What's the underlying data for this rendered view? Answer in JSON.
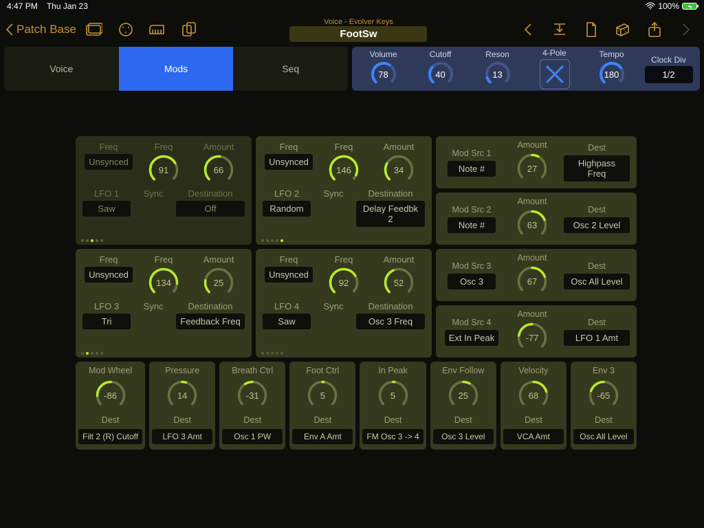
{
  "status": {
    "time": "4:47 PM",
    "date": "Thu Jan 23",
    "battery": "100%"
  },
  "nav": {
    "back": "Patch Base",
    "title_top": "Voice - Evolver Keys",
    "title_main": "FootSw"
  },
  "tabs": [
    "Voice",
    "Mods",
    "Seq"
  ],
  "active_tab": 1,
  "globals": {
    "volume": {
      "label": "Volume",
      "value": 78,
      "pct": 0.62
    },
    "cutoff": {
      "label": "Cutoff",
      "value": 40,
      "pct": 0.31
    },
    "reson": {
      "label": "Reson",
      "value": 13,
      "pct": 0.1
    },
    "pole": {
      "label": "4-Pole"
    },
    "tempo": {
      "label": "Tempo",
      "value": 180,
      "pct": 0.7
    },
    "clock": {
      "label": "Clock Div",
      "value": "1/2"
    }
  },
  "lfos": [
    {
      "name": "LFO 1",
      "dim": true,
      "freq_mode": "Unsynced",
      "freq": 91,
      "freq_pct": 0.72,
      "amount": 66,
      "amount_pct": 0.52,
      "sync": "Sync",
      "dest_lbl": "Destination",
      "wave": "Saw",
      "dest": "Off",
      "dots": [
        0,
        0,
        1,
        0,
        0
      ]
    },
    {
      "name": "LFO 2",
      "dim": false,
      "freq_mode": "Unsynced",
      "freq": 146,
      "freq_pct": 0.92,
      "amount": 34,
      "amount_pct": 0.27,
      "sync": "Sync",
      "dest_lbl": "Destination",
      "wave": "Random",
      "dest": "Delay Feedbk 2",
      "dots": [
        0,
        0,
        0,
        0,
        1
      ]
    },
    {
      "name": "LFO 3",
      "dim": false,
      "freq_mode": "Unsynced",
      "freq": 134,
      "freq_pct": 0.85,
      "amount": 25,
      "amount_pct": 0.2,
      "sync": "Sync",
      "dest_lbl": "Destination",
      "wave": "Tri",
      "dest": "Feedback Freq",
      "dots": [
        0,
        1,
        0,
        0,
        0
      ]
    },
    {
      "name": "LFO 4",
      "dim": false,
      "freq_mode": "Unsynced",
      "freq": 92,
      "freq_pct": 0.72,
      "amount": 52,
      "amount_pct": 0.41,
      "sync": "Sync",
      "dest_lbl": "Destination",
      "wave": "Saw",
      "dest": "Osc 3 Freq",
      "dots": [
        0,
        0,
        0,
        0,
        0
      ]
    }
  ],
  "mods": [
    {
      "label": "Mod Src 1",
      "src": "Note #",
      "amount": 27,
      "bipct": 0.6,
      "dest": "Highpass Freq"
    },
    {
      "label": "Mod Src 2",
      "src": "Note #",
      "amount": 63,
      "bipct": 0.75,
      "dest": "Osc 2 Level"
    },
    {
      "label": "Mod Src 3",
      "src": "Osc 3",
      "amount": 67,
      "bipct": 0.76,
      "dest": "Osc All Level"
    },
    {
      "label": "Mod Src 4",
      "src": "Ext In Peak",
      "amount": -77,
      "bipct": 0.2,
      "dest": "LFO 1 Amt"
    }
  ],
  "strip": [
    {
      "label": "Mod Wheel",
      "value": -86,
      "bipct": 0.16,
      "dest_lbl": "Dest",
      "dest": "Filt 2 (R) Cutoff"
    },
    {
      "label": "Pressure",
      "value": 14,
      "bipct": 0.56,
      "dest_lbl": "Dest",
      "dest": "LFO 3 Amt"
    },
    {
      "label": "Breath Ctrl",
      "value": -31,
      "bipct": 0.38,
      "dest_lbl": "Dest",
      "dest": "Osc 1 PW"
    },
    {
      "label": "Foot Ctrl",
      "value": 5,
      "bipct": 0.52,
      "dest_lbl": "Dest",
      "dest": "Env A Amt"
    },
    {
      "label": "In Peak",
      "value": 5,
      "bipct": 0.52,
      "dest_lbl": "Dest",
      "dest": "FM Osc 3 -> 4"
    },
    {
      "label": "Env Follow",
      "value": 25,
      "bipct": 0.6,
      "dest_lbl": "Dest",
      "dest": "Osc 3 Level"
    },
    {
      "label": "Velocity",
      "value": 68,
      "bipct": 0.77,
      "dest_lbl": "Dest",
      "dest": "VCA Amt"
    },
    {
      "label": "Env 3",
      "value": -65,
      "bipct": 0.24,
      "dest_lbl": "Dest",
      "dest": "Osc All Level"
    }
  ]
}
